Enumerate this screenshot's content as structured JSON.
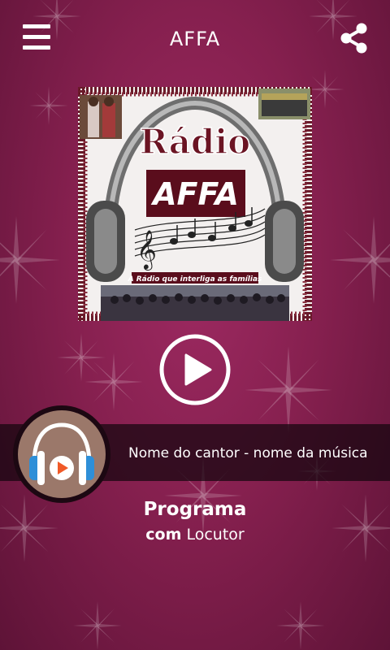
{
  "header": {
    "title": "AFFA",
    "menu_icon": "hamburger-menu-icon",
    "share_icon": "share-icon"
  },
  "cover": {
    "word_radio": "Rádio",
    "word_affa": "AFFA",
    "tagline": "A Rádio que interliga as famílias"
  },
  "player": {
    "play_icon": "play-icon",
    "track": "Nome do cantor - nome da música",
    "avatar_icon": "headphones-icon"
  },
  "program": {
    "title": "Programa",
    "host_prefix": "com",
    "host_name": "Locutor"
  },
  "colors": {
    "background": "#86204f",
    "bar": "#14060e",
    "avatar": "#9b786a",
    "headphone_blue": "#2e8fd8",
    "play_orange": "#f05a28"
  }
}
